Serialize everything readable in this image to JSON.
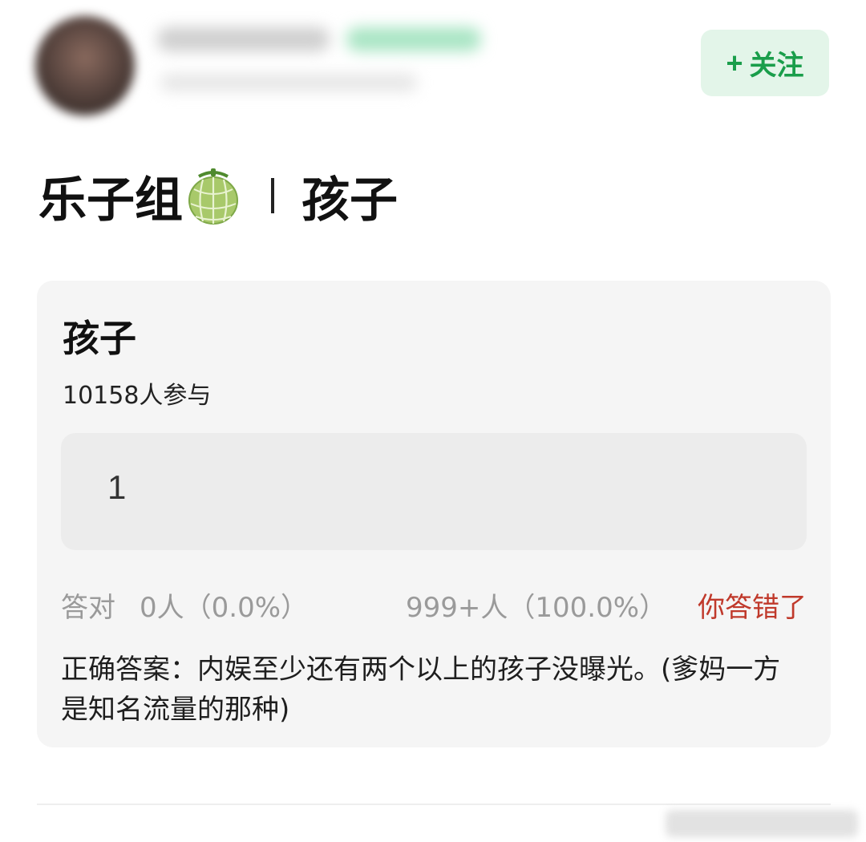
{
  "header": {
    "follow_label": "关注",
    "follow_icon": "plus-icon",
    "accent_color": "#1a9e4b"
  },
  "post": {
    "title_left": "乐子组",
    "title_right": "孩子",
    "emoji": "melon-icon"
  },
  "quiz": {
    "question": "孩子",
    "participants": "10158人参与",
    "options": [
      {
        "label": "1"
      }
    ],
    "correct_label": "答对",
    "correct_count": "0人（0.0%）",
    "wrong_count": "999+人（100.0%）",
    "wrong_label": "你答错了",
    "answer": "正确答案：内娱至少还有两个以上的孩子没曝光。(爹妈一方是知名流量的那种)",
    "wrong_color": "#c0392b"
  }
}
